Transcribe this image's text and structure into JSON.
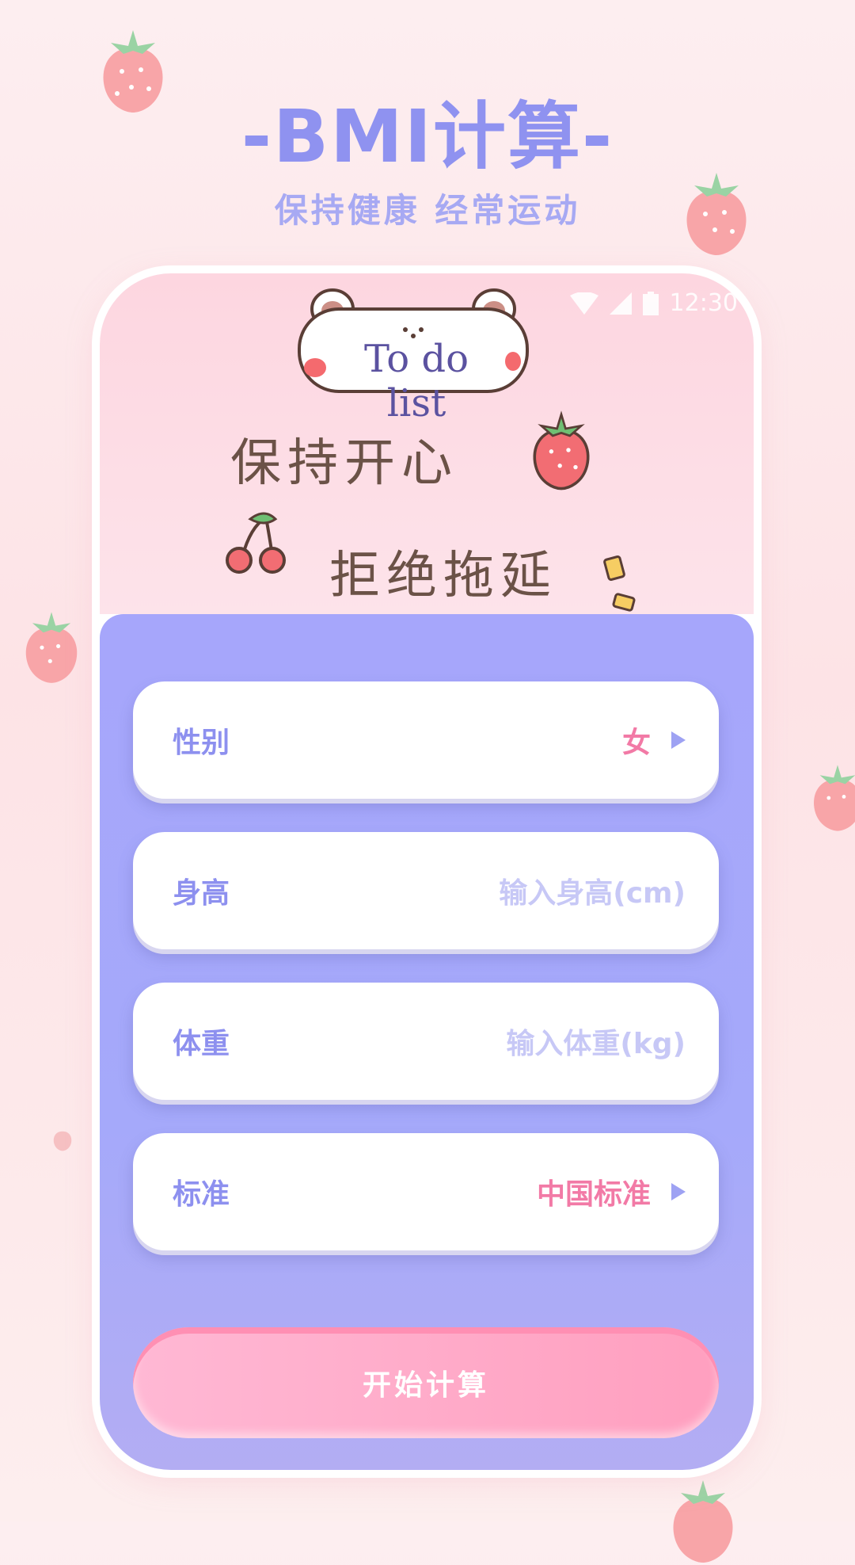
{
  "header": {
    "title": "-BMI计算-",
    "subtitle": "保持健康 经常运动"
  },
  "phone": {
    "status_time": "12:30",
    "badge_text": "To do list",
    "handwriting_1": "保持开心",
    "handwriting_2": "拒绝拖延"
  },
  "form": {
    "rows": [
      {
        "label": "性别",
        "value": "女"
      },
      {
        "label": "身高",
        "placeholder": "输入身高(cm)"
      },
      {
        "label": "体重",
        "placeholder": "输入体重(kg)"
      },
      {
        "label": "标准",
        "value": "中国标准"
      }
    ],
    "submit_label": "开始计算"
  },
  "colors": {
    "accent_purple": "#8f92f0",
    "accent_pink": "#f27aa6",
    "panel": "#a6a6fb"
  },
  "icons": [
    "strawberry-icon",
    "bear-icon",
    "cherry-icon",
    "arrow-right-icon",
    "wifi-icon",
    "signal-icon",
    "battery-icon"
  ]
}
